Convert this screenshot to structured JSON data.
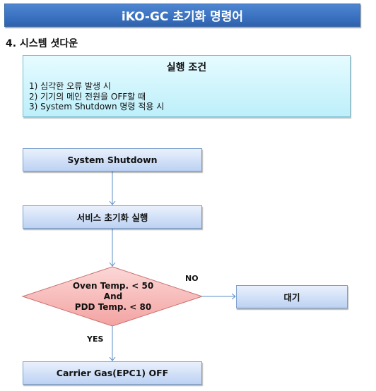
{
  "header": {
    "title": "iKO-GC 초기화 명령어"
  },
  "section": {
    "title": "4. 시스템 셧다운"
  },
  "conditions": {
    "title": "실행 조건",
    "items": [
      "1) 심각한 오류 발생 시",
      "2) 기기의 메인 전원을 OFF할 때",
      "3) System Shutdown 명령 적용 시"
    ]
  },
  "flowchart": {
    "nodes": {
      "start": "System Shutdown",
      "init": "서비스 초기화 실행",
      "decision_lines": [
        "Oven Temp. < 50",
        "And",
        "PDD Temp. < 80"
      ],
      "wait": "대기",
      "final": "Carrier Gas(EPC1) OFF"
    },
    "edges": {
      "no_label": "NO",
      "yes_label": "YES"
    }
  },
  "colors": {
    "header": "#3b73c2",
    "info_box": "#bdeffa",
    "process_box": "#bcd2f3",
    "decision": "#f4a9a7",
    "connector": "#5b8cc8"
  }
}
